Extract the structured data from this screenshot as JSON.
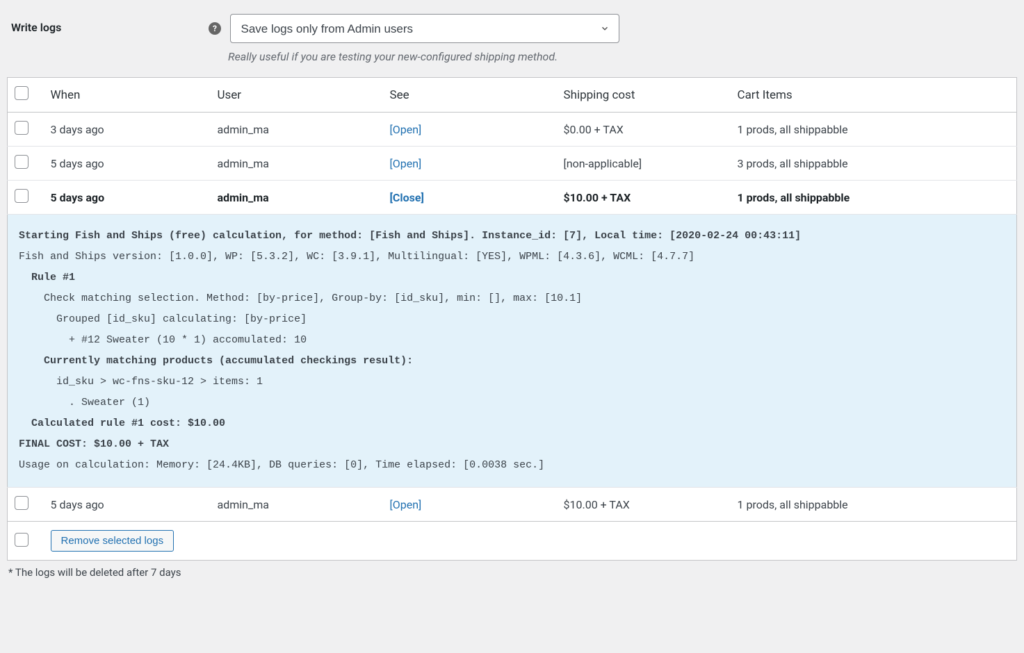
{
  "settings": {
    "label": "Write logs",
    "dropdown_value": "Save logs only from Admin users",
    "helper": "Really useful if you are testing your new-configured shipping method."
  },
  "table": {
    "headers": {
      "when": "When",
      "user": "User",
      "see": "See",
      "cost": "Shipping cost",
      "items": "Cart Items"
    },
    "rows": [
      {
        "when": "3 days ago",
        "user": "admin_ma",
        "see": "[Open]",
        "cost": "$0.00 + TAX",
        "items": "1 prods, all shippabble",
        "expanded": false
      },
      {
        "when": "5 days ago",
        "user": "admin_ma",
        "see": "[Open]",
        "cost": "[non-applicable]",
        "items": "3 prods, all shippabble",
        "expanded": false
      },
      {
        "when": "5 days ago",
        "user": "admin_ma",
        "see": "[Close]",
        "cost": "$10.00 + TAX",
        "items": "1 prods, all shippabble",
        "expanded": true
      },
      {
        "when": "5 days ago",
        "user": "admin_ma",
        "see": "[Open]",
        "cost": "$10.00 + TAX",
        "items": "1 prods, all shippabble",
        "expanded": false
      }
    ],
    "remove_label": "Remove selected logs"
  },
  "detail": {
    "lines": [
      {
        "text": "Starting Fish and Ships (free) calculation, for method: [Fish and Ships]. Instance_id: [7], Local time: [2020-02-24 00:43:11]",
        "bold": true,
        "indent": 0
      },
      {
        "text": "Fish and Ships version: [1.0.0], WP: [5.3.2], WC: [3.9.1], Multilingual: [YES], WPML: [4.3.6], WCML: [4.7.7]",
        "bold": false,
        "indent": 0
      },
      {
        "text": "Rule #1",
        "bold": true,
        "indent": 1
      },
      {
        "text": "Check matching selection. Method: [by-price], Group-by: [id_sku], min: [], max: [10.1]",
        "bold": false,
        "indent": 2
      },
      {
        "text": "Grouped [id_sku] calculating: [by-price]",
        "bold": false,
        "indent": 3
      },
      {
        "text": "+ #12 Sweater (10 * 1) accomulated: 10",
        "bold": false,
        "indent": 4
      },
      {
        "text": "Currently matching products (accumulated checkings result):",
        "bold": true,
        "indent": 2
      },
      {
        "text": "id_sku > wc-fns-sku-12 > items: 1",
        "bold": false,
        "indent": 3
      },
      {
        "text": ". Sweater (1)",
        "bold": false,
        "indent": 4
      },
      {
        "text": "Calculated rule #1 cost: $10.00",
        "bold": true,
        "indent": 1
      },
      {
        "text": "FINAL COST: $10.00 + TAX",
        "bold": true,
        "indent": 0
      },
      {
        "text": "Usage on calculation: Memory: [24.4KB], DB queries: [0], Time elapsed: [0.0038 sec.]",
        "bold": false,
        "indent": 0
      }
    ]
  },
  "footer_note": "* The logs will be deleted after 7 days"
}
